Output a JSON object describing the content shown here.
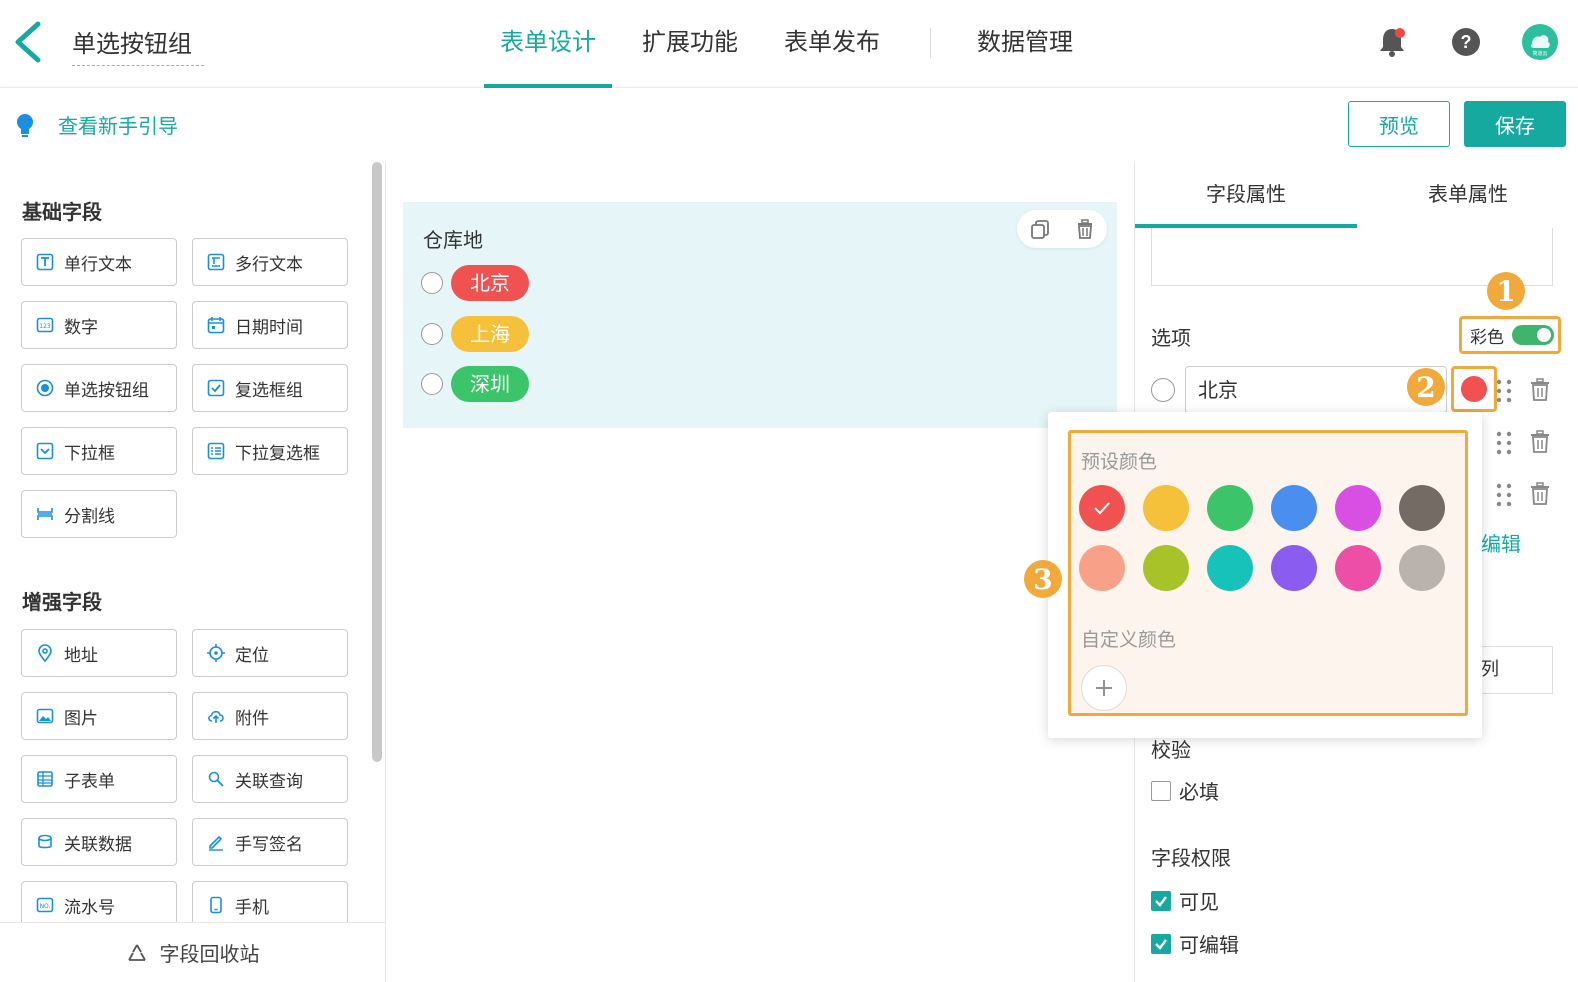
{
  "header": {
    "form_title": "单选按钮组",
    "tabs": [
      "表单设计",
      "扩展功能",
      "表单发布",
      "数据管理"
    ],
    "active_tab": 0,
    "icons": [
      "bell-icon",
      "help-icon",
      "avatar"
    ],
    "avatar_text": "简道云"
  },
  "subbar": {
    "guide_label": "查看新手引导",
    "preview_label": "预览",
    "save_label": "保存"
  },
  "colors": {
    "accent": "#16a9a0",
    "highlight": "#f0a93a"
  },
  "left_panel": {
    "basic_title": "基础字段",
    "basic_fields": [
      {
        "label": "单行文本",
        "icon": "text-icon"
      },
      {
        "label": "多行文本",
        "icon": "textarea-icon"
      },
      {
        "label": "数字",
        "icon": "number-icon"
      },
      {
        "label": "日期时间",
        "icon": "calendar-icon"
      },
      {
        "label": "单选按钮组",
        "icon": "radio-icon"
      },
      {
        "label": "复选框组",
        "icon": "checkbox-icon"
      },
      {
        "label": "下拉框",
        "icon": "dropdown-icon"
      },
      {
        "label": "下拉复选框",
        "icon": "multiselect-icon"
      },
      {
        "label": "分割线",
        "icon": "divider-icon"
      }
    ],
    "enhanced_title": "增强字段",
    "enhanced_fields": [
      {
        "label": "地址",
        "icon": "location-pin-icon"
      },
      {
        "label": "定位",
        "icon": "crosshair-icon"
      },
      {
        "label": "图片",
        "icon": "image-icon"
      },
      {
        "label": "附件",
        "icon": "upload-cloud-icon"
      },
      {
        "label": "子表单",
        "icon": "subform-icon"
      },
      {
        "label": "关联查询",
        "icon": "link-search-icon"
      },
      {
        "label": "关联数据",
        "icon": "link-data-icon"
      },
      {
        "label": "手写签名",
        "icon": "pen-icon"
      },
      {
        "label": "流水号",
        "icon": "serial-icon"
      },
      {
        "label": "手机",
        "icon": "phone-icon"
      }
    ],
    "recycle_label": "字段回收站"
  },
  "canvas": {
    "field_label": "仓库地",
    "options": [
      {
        "label": "北京",
        "color": "#f05252"
      },
      {
        "label": "上海",
        "color": "#f5c03a"
      },
      {
        "label": "深圳",
        "color": "#3cc46a"
      }
    ]
  },
  "right_panel": {
    "tabs": [
      "字段属性",
      "表单属性"
    ],
    "active_tab": 0,
    "options_title": "选项",
    "color_toggle_label": "彩色",
    "color_toggle_on": true,
    "first_option_value": "北京",
    "edit_link_partial": "编辑",
    "partial_input_text": "列",
    "validation_title": "校验",
    "required_label": "必填",
    "required_checked": false,
    "permission_title": "字段权限",
    "visible_label": "可见",
    "visible_checked": true,
    "editable_label": "可编辑",
    "editable_checked": true
  },
  "color_popover": {
    "preset_label": "预设颜色",
    "custom_label": "自定义颜色",
    "selected_index": 0,
    "preset_colors": [
      "#f05252",
      "#f5c03a",
      "#3cc46a",
      "#4a8fef",
      "#d94fe3",
      "#756b65",
      "#f9a088",
      "#a8c22a",
      "#17c2b8",
      "#8a5cf0",
      "#ee4fa6",
      "#bab3ad"
    ]
  },
  "annotations": [
    "1",
    "2",
    "3"
  ]
}
